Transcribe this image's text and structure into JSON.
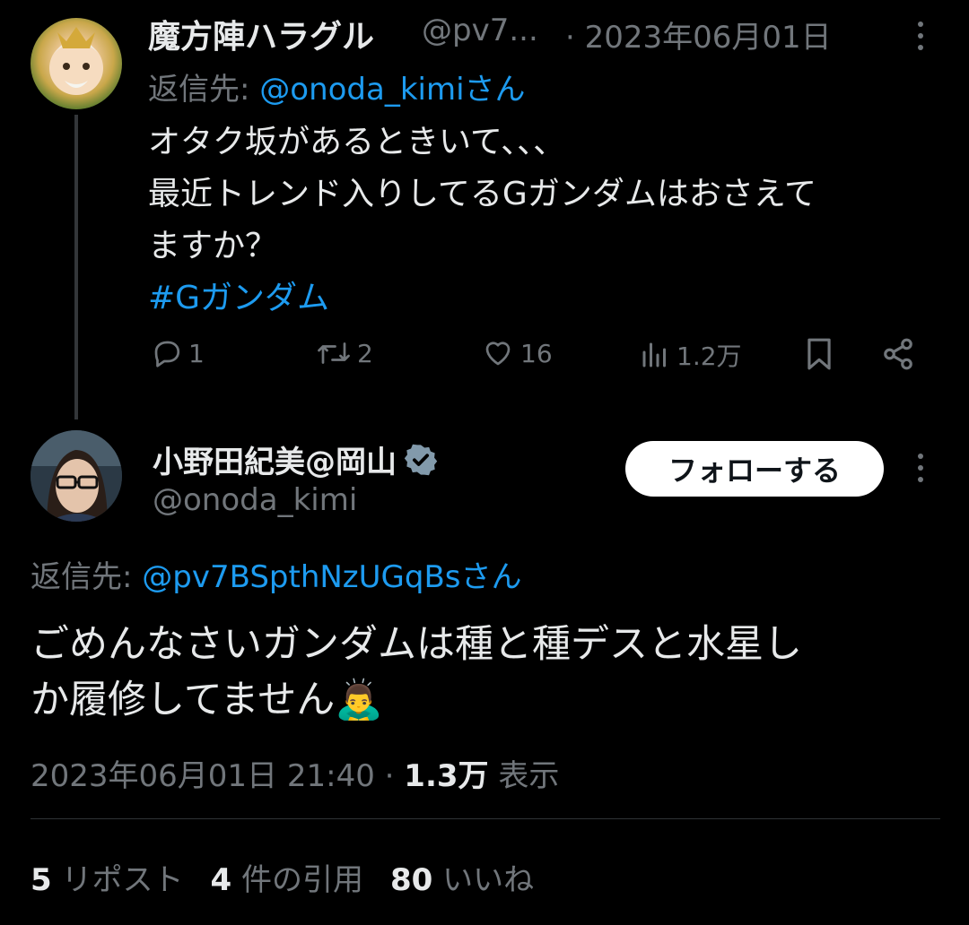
{
  "reply_tweet": {
    "display_name": "魔方陣ハラグル",
    "handle": "@pv7...",
    "date": "· 2023年06月01日",
    "reply_to_label": "返信先: ",
    "reply_to_handle": "@onoda_kimiさん",
    "text_lines": [
      "オタク坂があるときいて、、、",
      "最近トレンド入りしてるGガンダムはおさえて",
      "ますか？"
    ],
    "hashtag": "#Gガンダム",
    "actions": {
      "replies": "1",
      "reposts": "2",
      "likes": "16",
      "views": "1.2万"
    },
    "icons": [
      "reply-icon",
      "repost-icon",
      "like-icon",
      "views-icon",
      "bookmark-icon",
      "share-icon"
    ]
  },
  "main_tweet": {
    "display_name": "小野田紀美@岡山",
    "verified_icon": "verified-badge-icon",
    "handle": "@onoda_kimi",
    "follow_label": "フォローする",
    "reply_to_label": "返信先: ",
    "reply_to_handle": "@pv7BSpthNzUGqBsさん",
    "text_line1": "ごめんなさいガンダムは種と種デスと水星し",
    "text_line2": "か履修してません",
    "emoji": "🙇‍♂️",
    "timestamp": "2023年06月01日 21:40",
    "separator": "·",
    "views_count": "1.3万",
    "views_label": "表示"
  },
  "stats": {
    "reposts_count": "5",
    "reposts_label": "リポスト",
    "quotes_count": "4",
    "quotes_label": "件の引用",
    "likes_count": "80",
    "likes_label": "いいね"
  },
  "colors": {
    "background": "#000000",
    "text": "#e7e9ea",
    "muted": "#71767b",
    "link": "#1d9bf0",
    "verified": "#829aab"
  }
}
